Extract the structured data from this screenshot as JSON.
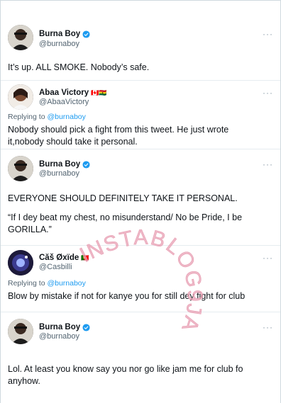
{
  "tweets": [
    {
      "name": "Burna Boy",
      "handle": "@burnaboy",
      "verified": true,
      "text": "It’s up. ALL SMOKE. Nobody’s safe."
    },
    {
      "name": "Abaa Victory",
      "flags": "🇨🇦🇬🇭",
      "handle": "@AbaaVictory",
      "replying_prefix": "Replying to ",
      "replying_to": "@burnaboy",
      "text_line1": "Nobody should pick a fight from this tweet. He just wrote",
      "text_line2": "it,nobody should take it personal."
    },
    {
      "name": "Burna Boy",
      "handle": "@burnaboy",
      "verified": true,
      "text_line1": "EVERYONE SHOULD DEFINITELY TAKE IT PERSONAL.",
      "text_line2": "“If I dey beat my chest, no misunderstand/ No be Pride, I be",
      "text_line3": "GORILLA.”"
    },
    {
      "name": "Căš Øxïde",
      "flags": "🇵🇹",
      "handle": "@Casbilli",
      "replying_prefix": "Replying to ",
      "replying_to": "@burnaboy",
      "text": "Blow by mistake if not for kanye you for still dey fight for club"
    },
    {
      "name": "Burna Boy",
      "handle": "@burnaboy",
      "verified": true,
      "text_line1": "Lol. At least you know say you nor go like jam me for club fo",
      "text_line2": "anyhow."
    }
  ],
  "more_label": "···",
  "watermark": "INSTABLOG9JA",
  "colors": {
    "link": "#1d9bf0",
    "verified": "#1d9bf0",
    "watermark": "#e8a0b4"
  }
}
